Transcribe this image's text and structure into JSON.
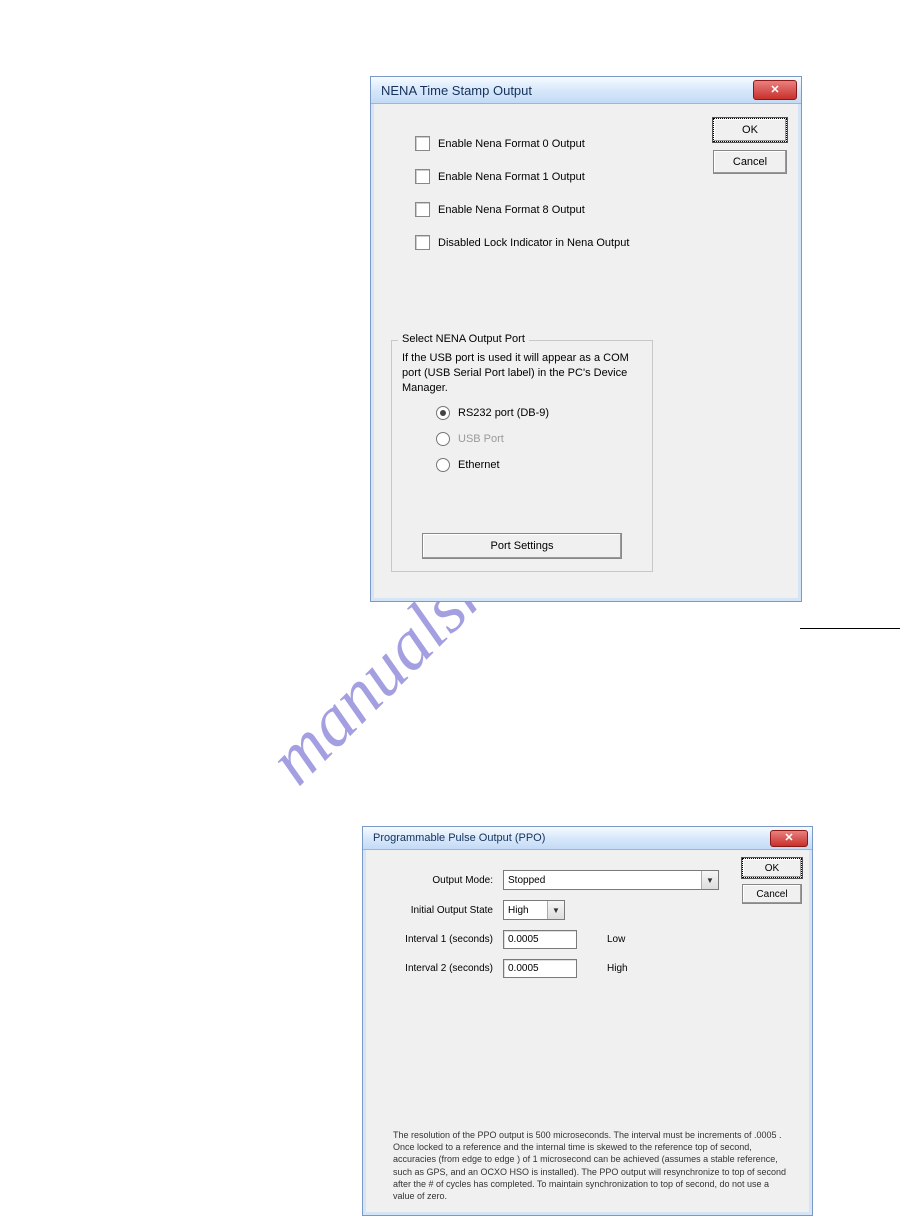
{
  "watermark": "manualshive.com",
  "dialog1": {
    "title": "NENA Time Stamp Output",
    "ok": "OK",
    "cancel": "Cancel",
    "checkboxes": [
      "Enable Nena Format 0 Output",
      "Enable Nena Format 1 Output",
      "Enable Nena Format 8 Output",
      "Disabled Lock Indicator in Nena Output"
    ],
    "group": {
      "legend": "Select NENA Output Port",
      "note": "If the USB port is used it will appear as a COM port (USB Serial Port label) in the PC's Device Manager.",
      "radios": [
        "RS232 port (DB-9)",
        "USB Port",
        "Ethernet"
      ],
      "port_settings": "Port Settings"
    }
  },
  "dialog2": {
    "title": "Programmable Pulse Output (PPO)",
    "ok": "OK",
    "cancel": "Cancel",
    "fields": {
      "output_mode_label": "Output Mode:",
      "output_mode_value": "Stopped",
      "initial_state_label": "Initial Output State",
      "initial_state_value": "High",
      "interval1_label": "Interval 1 (seconds)",
      "interval1_value": "0.0005",
      "interval1_suffix": "Low",
      "interval2_label": "Interval 2 (seconds)",
      "interval2_value": "0.0005",
      "interval2_suffix": "High"
    },
    "footnote": "The resolution of the PPO output is 500 microseconds. The interval must be increments of .0005 . Once locked to a reference and the internal time is skewed to the reference top of second, accuracies (from edge to edge ) of 1 microsecond can be achieved (assumes a stable reference, such as GPS, and an OCXO HSO is installed). The PPO output will resynchronize to top of second after the # of cycles has completed. To maintain synchronization to top of second, do not use a value of zero."
  }
}
